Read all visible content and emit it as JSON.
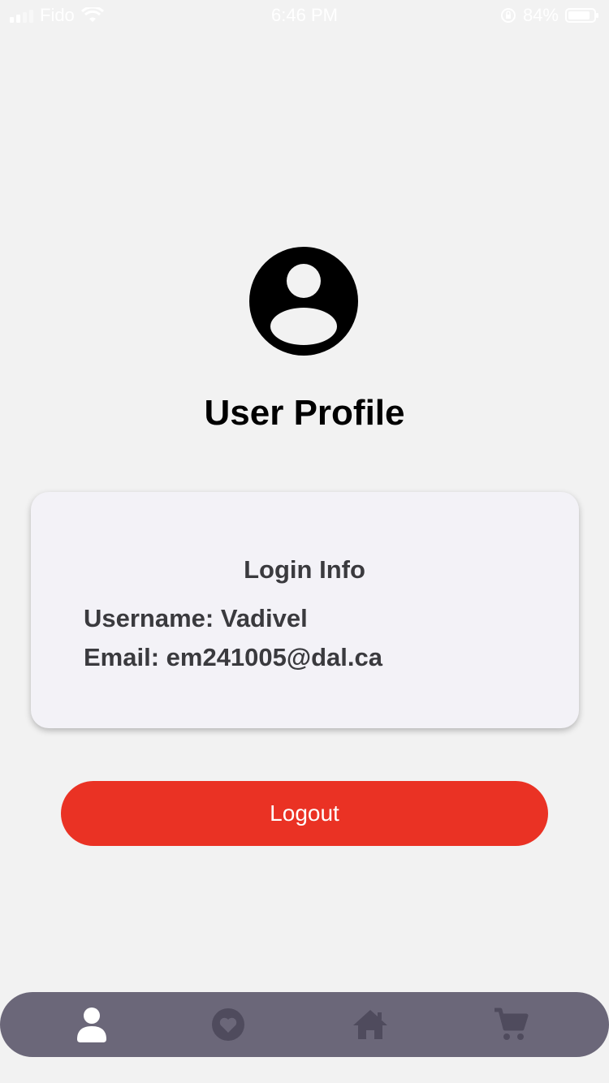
{
  "status_bar": {
    "carrier": "Fido",
    "time": "6:46 PM",
    "battery": "84%",
    "battery_level": 0.84,
    "icons": [
      "signal-icon",
      "wifi-icon",
      "orientation-lock-icon",
      "battery-icon"
    ]
  },
  "profile": {
    "avatar_icon": "account-circle-icon",
    "title": "User Profile"
  },
  "login_info": {
    "title": "Login Info",
    "username_line": "Username: Vadivel",
    "email_line": "Email: em241005@dal.ca"
  },
  "actions": {
    "logout_label": "Logout"
  },
  "bottom_nav": {
    "items": [
      {
        "icon": "person-icon",
        "active": true
      },
      {
        "icon": "heart-icon",
        "active": false
      },
      {
        "icon": "home-icon",
        "active": false
      },
      {
        "icon": "cart-icon",
        "active": false
      }
    ]
  },
  "colors": {
    "background": "#f2f2f2",
    "card": "#f3f2f7",
    "accent_red": "#ea3224",
    "nav_bar": "#6b6779",
    "nav_inactive_icon": "#4f4b5d",
    "nav_active_icon": "#ffffff"
  }
}
